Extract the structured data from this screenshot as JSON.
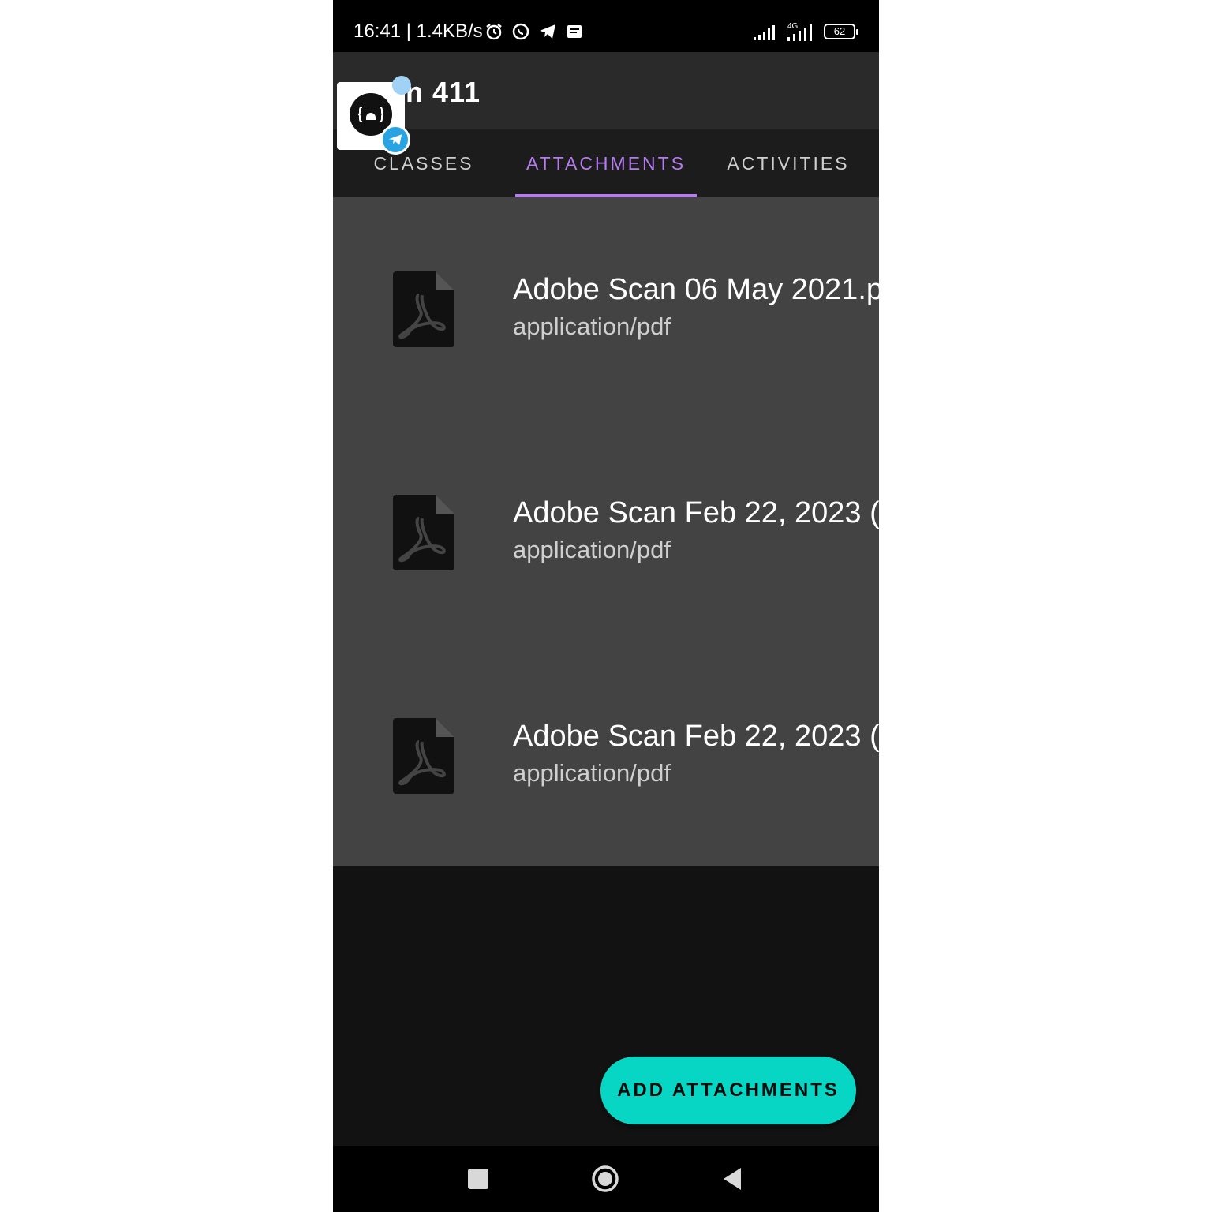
{
  "status_bar": {
    "time_speed": "16:41 | 1.4KB/s",
    "network_label": "4G",
    "battery_level": "62",
    "icons": [
      "alarm-icon",
      "whatsapp-icon",
      "telegram-icon",
      "message-icon",
      "signal-icon",
      "signal-4g-icon",
      "battery-icon"
    ]
  },
  "app_bar": {
    "title": "n 411"
  },
  "overlay": {
    "icons": [
      "dev-bot-icon",
      "telegram-badge-icon"
    ]
  },
  "tabs": [
    {
      "label": "CLASSES",
      "active": false
    },
    {
      "label": "ATTACHMENTS",
      "active": true
    },
    {
      "label": "ACTIVITIES",
      "active": false
    }
  ],
  "attachments": [
    {
      "name": "Adobe Scan 06 May 2021.p",
      "type": "application/pdf",
      "icon": "pdf-file-icon"
    },
    {
      "name": "Adobe Scan Feb 22, 2023 (",
      "type": "application/pdf",
      "icon": "pdf-file-icon"
    },
    {
      "name": "Adobe Scan Feb 22, 2023 (",
      "type": "application/pdf",
      "icon": "pdf-file-icon"
    }
  ],
  "fab": {
    "label": "ADD ATTACHMENTS",
    "color": "#07d6c4"
  },
  "nav_bar": {
    "icons": [
      "recents-square-icon",
      "home-circle-icon",
      "back-triangle-icon"
    ]
  },
  "colors": {
    "accent": "#b47cf0",
    "list_bg": "#434343",
    "app_bg": "#121212"
  }
}
